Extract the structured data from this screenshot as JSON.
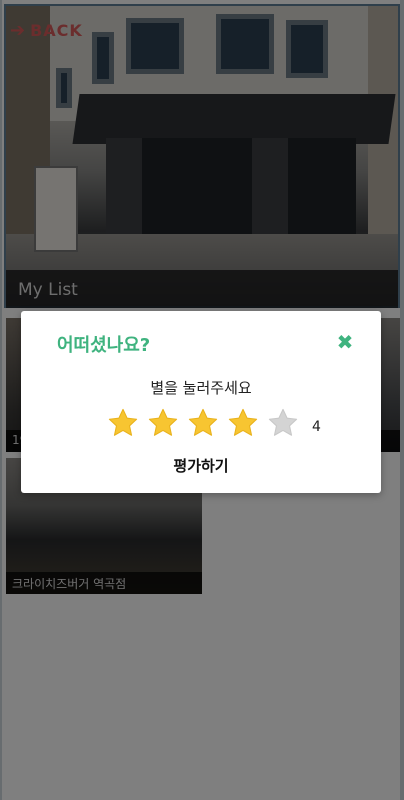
{
  "header": {
    "back_label": "BACK"
  },
  "hero": {
    "caption": "My List"
  },
  "list": {
    "items": [
      {
        "label": "19"
      },
      {
        "label": ""
      },
      {
        "label": "크라이치즈버거 역곡점"
      }
    ]
  },
  "modal": {
    "title": "어떠셨나요?",
    "subtitle": "별을 눌러주세요",
    "rating": 4,
    "max_rating": 5,
    "score_text": "4",
    "submit_label": "평가하기",
    "accent_color": "#3fb37f",
    "star_on_color": "#f7c531",
    "star_off_color": "#d4d4d4"
  }
}
